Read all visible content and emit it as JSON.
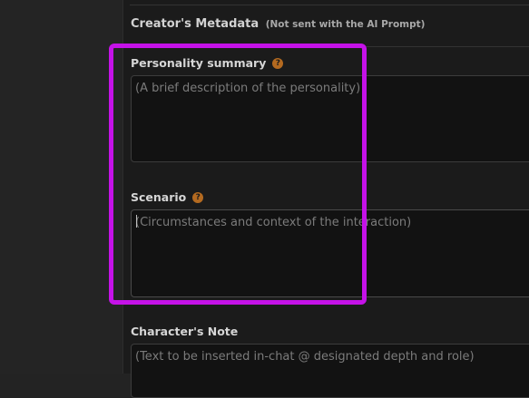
{
  "section": {
    "title": "Creator's Metadata",
    "note": "(Not sent with the AI Prompt)"
  },
  "fields": {
    "personality": {
      "label": "Personality summary",
      "placeholder": "(A brief description of the personality)",
      "value": ""
    },
    "scenario": {
      "label": "Scenario",
      "placeholder": "(Circumstances and context of the interaction)",
      "value": ""
    },
    "character_note": {
      "label": "Character's Note",
      "placeholder": "(Text to be inserted in-chat @ designated depth and role)",
      "value": ""
    }
  },
  "help_icon_glyph": "?",
  "colors": {
    "highlight": "#c512e8",
    "help_icon": "#b46a20",
    "panel_bg": "#1b1b1b"
  }
}
